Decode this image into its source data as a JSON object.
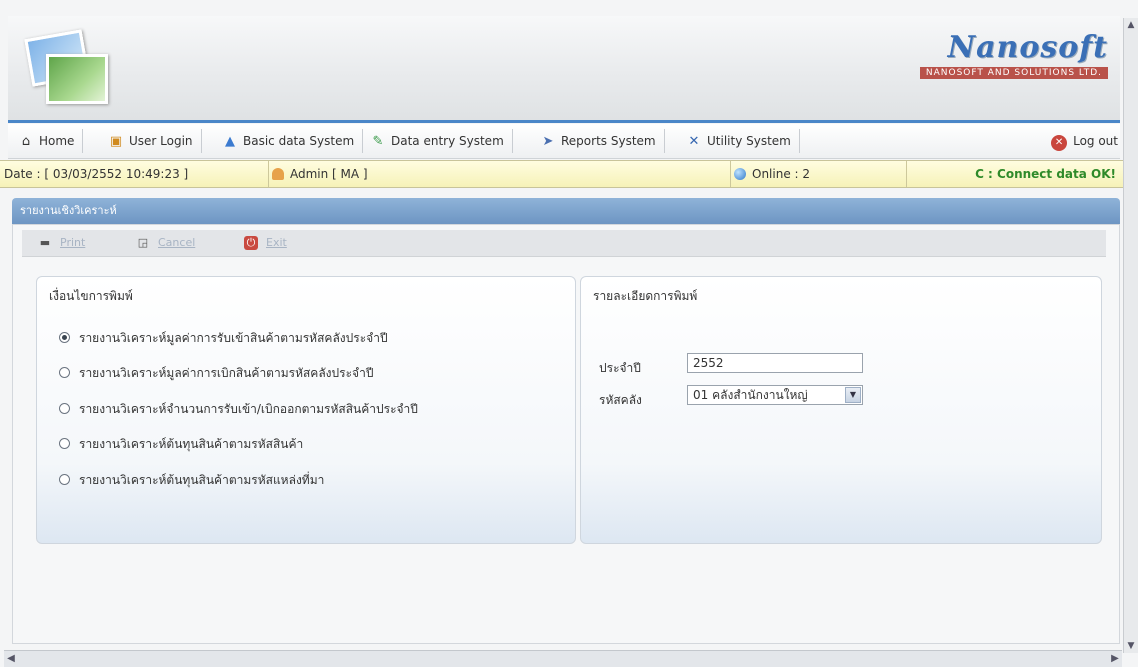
{
  "brand": {
    "name": "Nanosoft",
    "subtitle": "NANOSOFT AND SOLUTIONS LTD."
  },
  "menu": {
    "items": [
      {
        "label": "Home",
        "icon": "home-icon"
      },
      {
        "label": "User Login",
        "icon": "user-login-icon"
      },
      {
        "label": "Basic data System",
        "icon": "basic-data-icon"
      },
      {
        "label": "Data entry System",
        "icon": "data-entry-icon"
      },
      {
        "label": "Reports System",
        "icon": "reports-icon"
      },
      {
        "label": "Utility System",
        "icon": "utility-icon"
      }
    ],
    "logout_label": "Log out"
  },
  "status": {
    "date": "Date : [ 03/03/2552 10:49:23 ]",
    "user": "Admin [ MA ]",
    "online": "Online : 2",
    "connection": "C : Connect data OK!"
  },
  "panel": {
    "title": "รายงานเชิงวิเคราะห์"
  },
  "toolbar": {
    "print": "Print",
    "cancel": "Cancel",
    "exit": "Exit"
  },
  "conditions": {
    "title": "เงื่อนไขการพิมพ์",
    "options": [
      {
        "label": "รายงานวิเคราะห์มูลค่าการรับเข้าสินค้าตามรหัสคลังประจำปี",
        "checked": true
      },
      {
        "label": "รายงานวิเคราะห์มูลค่าการเบิกสินค้าตามรหัสคลังประจำปี",
        "checked": false
      },
      {
        "label": "รายงานวิเคราะห์จำนวนการรับเข้า/เบิกออกตามรหัสสินค้าประจำปี",
        "checked": false
      },
      {
        "label": "รายงานวิเคราะห์ต้นทุนสินค้าตามรหัสสินค้า",
        "checked": false
      },
      {
        "label": "รายงานวิเคราะห์ต้นทุนสินค้าตามรหัสแหล่งที่มา",
        "checked": false
      }
    ]
  },
  "details": {
    "title": "รายละเอียดการพิมพ์",
    "year_label": "ประจำปี",
    "year_value": "2552",
    "warehouse_label": "รหัสคลัง",
    "warehouse_value": "01   คลังสำนักงานใหญ่"
  },
  "colors": {
    "accent": "#4a86c8",
    "status_bg": "#fffde0",
    "connect_ok": "#2f8a2a"
  }
}
